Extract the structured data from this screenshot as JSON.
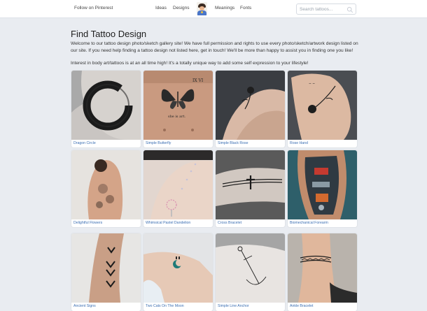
{
  "header": {
    "follow_label": "Follow on Pinterest",
    "nav": [
      "Ideas",
      "Designs",
      "Meanings",
      "Fonts"
    ],
    "search_placeholder": "Search tattoos..."
  },
  "page": {
    "title": "Find Tattoo Design",
    "intro": "Welcome to our tattoo design photo/sketch gallery site! We have full permission and rights to use every photo/sketch/artwork design listed on our site. If you need help finding a tattoo design not listed here, get in touch! We'll be more than happy to assist you in finding one you like!",
    "interest": "Interest in body art/tattoos is at an all time high! It's a totally unique way to add some self expression to your lifestyle!"
  },
  "gallery": [
    {
      "caption": "Dragon Circle",
      "image": "ink-circle-on-shoulder"
    },
    {
      "caption": "Simple Butterfly",
      "image": "butterfly-on-chest",
      "tattoo_text": [
        "IX VI",
        "she is art."
      ]
    },
    {
      "caption": "Simple Black Rose",
      "image": "rose-on-hand"
    },
    {
      "caption": "Rose Hand",
      "image": "rose-on-hand-with-script"
    },
    {
      "caption": "Delightful Flowers",
      "image": "floral-back-piece"
    },
    {
      "caption": "Whimsical Pastel Dandelion",
      "image": "dandelion-on-arm"
    },
    {
      "caption": "Cross Bracelet",
      "image": "cross-band-on-wrist"
    },
    {
      "caption": "Biomechanical Forearm",
      "image": "biomechanical-forearm"
    },
    {
      "caption": "Ancient Signs",
      "image": "arrow-signs-on-forearm"
    },
    {
      "caption": "Two Cats On The Moon",
      "image": "cats-on-moon"
    },
    {
      "caption": "Simple Line Anchor",
      "image": "anchor-on-arm"
    },
    {
      "caption": "Ankle Bracelet",
      "image": "ankle-band"
    }
  ],
  "colors": {
    "page_bg": "#e9ecf1",
    "caption_link": "#3c6fb3"
  }
}
